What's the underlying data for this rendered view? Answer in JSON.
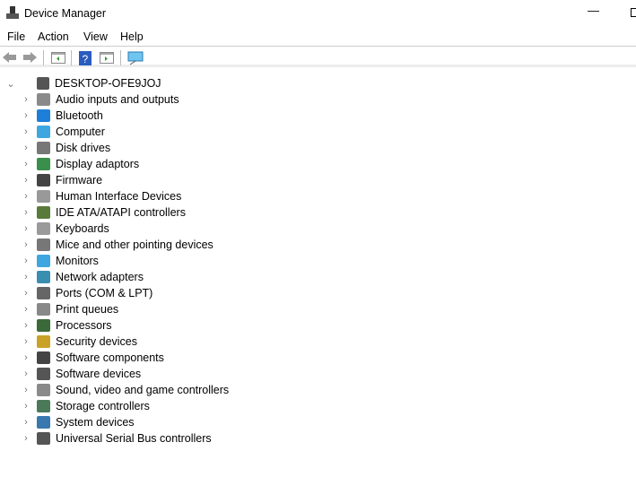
{
  "window": {
    "title": "Device Manager",
    "minimize": "—"
  },
  "menu": [
    "File",
    "Action",
    "View",
    "Help"
  ],
  "toolbar": [
    "back-icon",
    "forward-icon",
    "show-hide-console-tree-icon",
    "help-icon",
    "properties-icon",
    "scan-hardware-icon"
  ],
  "tree": {
    "root": "DESKTOP-OFE9JOJ",
    "items": [
      {
        "label": "Audio inputs and outputs",
        "icon": "speaker-icon",
        "color": "#8a8a8a"
      },
      {
        "label": "Bluetooth",
        "icon": "bluetooth-icon",
        "color": "#1e7fd8"
      },
      {
        "label": "Computer",
        "icon": "computer-icon",
        "color": "#3fa7e0"
      },
      {
        "label": "Disk drives",
        "icon": "disk-drive-icon",
        "color": "#777777"
      },
      {
        "label": "Display adaptors",
        "icon": "display-adapter-icon",
        "color": "#3a8f4a"
      },
      {
        "label": "Firmware",
        "icon": "firmware-icon",
        "color": "#444444"
      },
      {
        "label": "Human Interface Devices",
        "icon": "hid-icon",
        "color": "#999999"
      },
      {
        "label": "IDE ATA/ATAPI controllers",
        "icon": "ide-icon",
        "color": "#5a7a3a"
      },
      {
        "label": "Keyboards",
        "icon": "keyboard-icon",
        "color": "#9a9a9a"
      },
      {
        "label": "Mice and other pointing devices",
        "icon": "mouse-icon",
        "color": "#777777"
      },
      {
        "label": "Monitors",
        "icon": "monitor-icon",
        "color": "#3fa7e0"
      },
      {
        "label": "Network adapters",
        "icon": "network-icon",
        "color": "#3a8fb0"
      },
      {
        "label": "Ports (COM & LPT)",
        "icon": "port-icon",
        "color": "#666666"
      },
      {
        "label": "Print queues",
        "icon": "printer-icon",
        "color": "#888888"
      },
      {
        "label": "Processors",
        "icon": "processor-icon",
        "color": "#3a6a3a"
      },
      {
        "label": "Security devices",
        "icon": "security-icon",
        "color": "#c9a227"
      },
      {
        "label": "Software components",
        "icon": "software-component-icon",
        "color": "#444444"
      },
      {
        "label": "Software devices",
        "icon": "software-device-icon",
        "color": "#555555"
      },
      {
        "label": "Sound, video and game controllers",
        "icon": "sound-icon",
        "color": "#8a8a8a"
      },
      {
        "label": "Storage controllers",
        "icon": "storage-icon",
        "color": "#4a7a5a"
      },
      {
        "label": "System devices",
        "icon": "system-icon",
        "color": "#3a78b0"
      },
      {
        "label": "Universal Serial Bus controllers",
        "icon": "usb-icon",
        "color": "#555555"
      }
    ]
  }
}
